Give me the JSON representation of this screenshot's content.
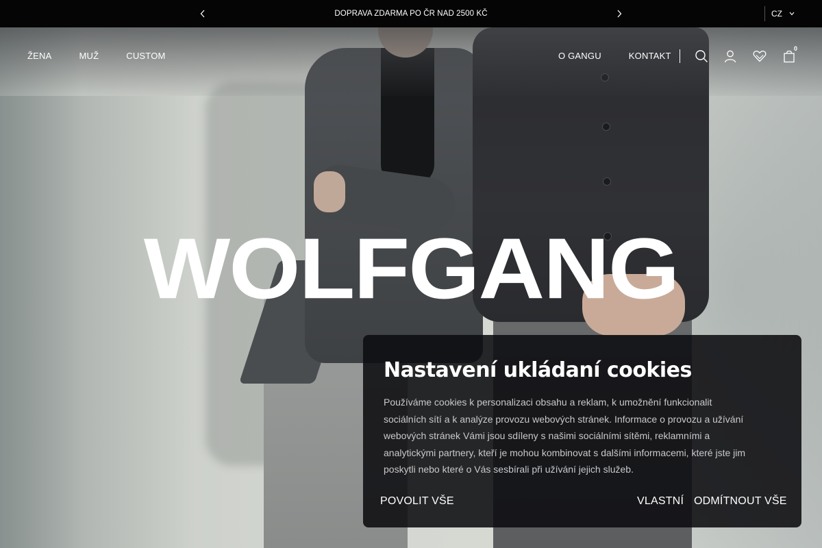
{
  "announcement": {
    "text": "DOPRAVA ZDARMA PO ČR NAD 2500 KČ",
    "prev_icon": "chevron-left-icon",
    "next_icon": "chevron-right-icon"
  },
  "language": {
    "selected": "CZ",
    "icon": "chevron-down-icon"
  },
  "nav": {
    "left": [
      "ŽENA",
      "MUŽ",
      "CUSTOM"
    ],
    "right": [
      "O GANGU",
      "KONTAKT"
    ],
    "icons": [
      "search-icon",
      "account-icon",
      "wishlist-heart-icon",
      "cart-bag-icon"
    ],
    "cart_count": "0"
  },
  "hero": {
    "brand": "WOLFGANG"
  },
  "cookies": {
    "title": "Nastavení ukládaní cookies",
    "text": "Používáme cookies k personalizaci obsahu a reklam, k umožnění funkcionalit sociálních sítí a k analýze provozu webových stránek. Informace o provozu a užívání webových stránek Vámi jsou sdíleny s našimi sociálními sítěmi, reklamními a analytickými partnery, kteří je mohou kombinovat s dalšími informacemi, které jste jim poskytli nebo které o Vás sesbírali při užívání jejich služeb.",
    "allow_all": "POVOLIT VŠE",
    "custom": "VLASTNÍ",
    "reject_all": "ODMÍTNOUT VŠE"
  },
  "colors": {
    "topbar_bg": "#050505",
    "panel_bg": "#0c0d10",
    "text_light": "#ffffff"
  }
}
